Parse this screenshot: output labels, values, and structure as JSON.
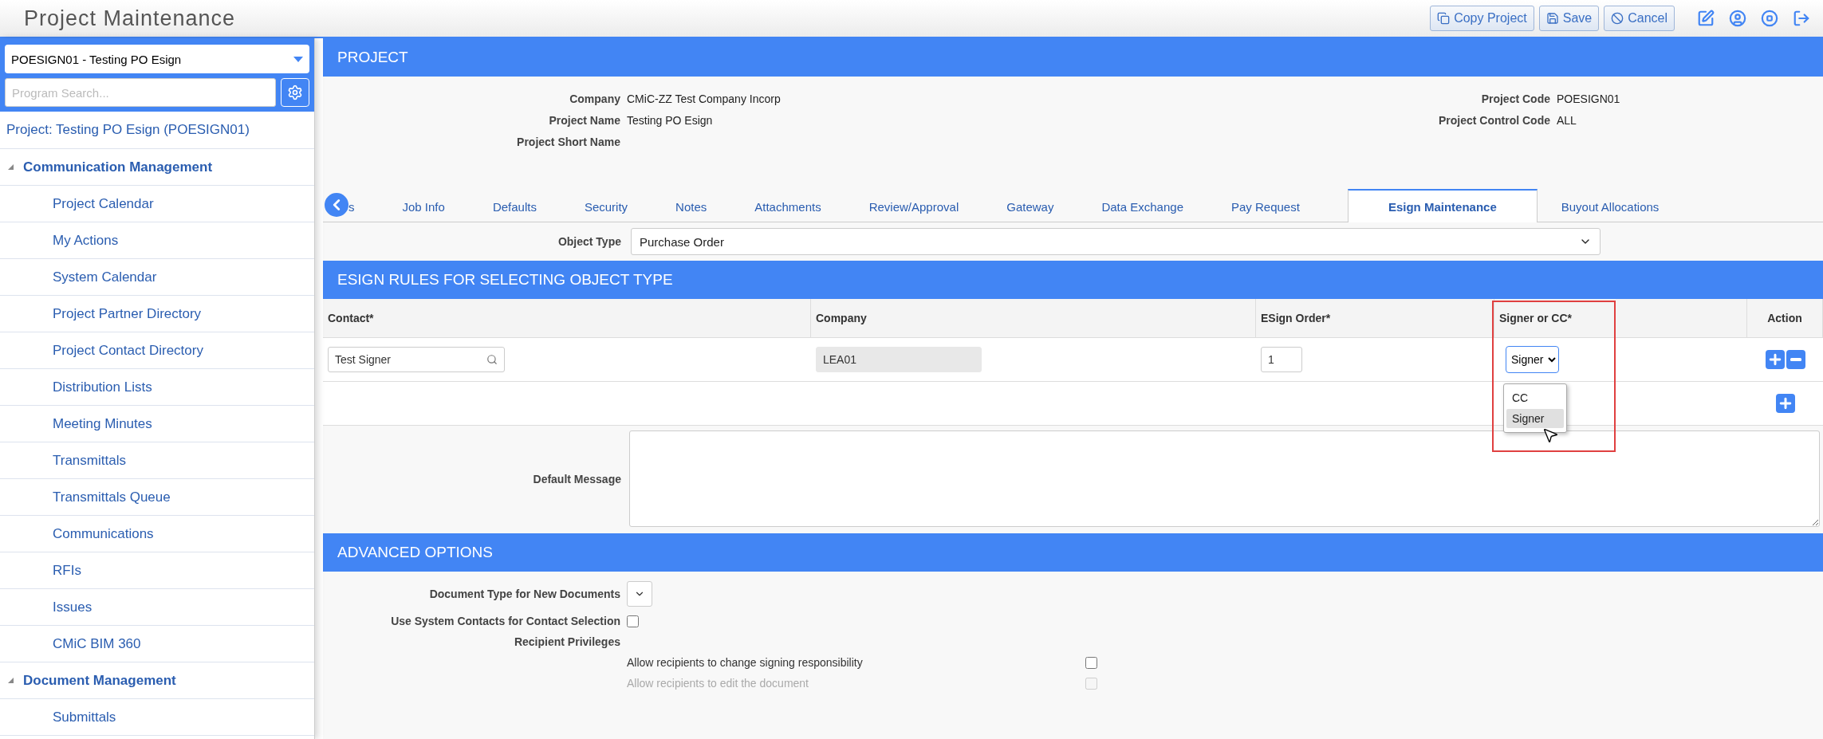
{
  "app": {
    "title": "Project Maintenance",
    "actions": [
      {
        "kind": "copy",
        "label": "Copy Project"
      },
      {
        "kind": "save",
        "label": "Save"
      },
      {
        "kind": "cancel",
        "label": "Cancel"
      }
    ],
    "tools": [
      {
        "kind": "edit"
      },
      {
        "kind": "user"
      },
      {
        "kind": "stop"
      },
      {
        "kind": "logout"
      }
    ]
  },
  "sidebar": {
    "project_select": "POESIGN01 - Testing PO Esign",
    "search": {
      "placeholder": "Program Search..."
    },
    "project_link": "Project: Testing PO Esign (POESIGN01)",
    "groups": [
      {
        "label": "Communication Management",
        "expanded": true,
        "children": [
          {
            "label": "Project Calendar"
          },
          {
            "label": "My Actions"
          },
          {
            "label": "System Calendar"
          },
          {
            "label": "Project Partner Directory"
          },
          {
            "label": "Project Contact Directory"
          },
          {
            "label": "Distribution Lists"
          },
          {
            "label": "Meeting Minutes"
          },
          {
            "label": "Transmittals"
          },
          {
            "label": "Transmittals Queue"
          },
          {
            "label": "Communications"
          },
          {
            "label": "RFIs"
          },
          {
            "label": "Issues"
          },
          {
            "label": "CMiC BIM 360"
          }
        ]
      },
      {
        "label": "Document Management",
        "expanded": true,
        "children": [
          {
            "label": "Submittals"
          }
        ]
      }
    ]
  },
  "project": {
    "header": "PROJECT",
    "fields_left": [
      {
        "label": "Company",
        "value": "CMiC-ZZ Test Company Incorp"
      },
      {
        "label": "Project Name",
        "value": "Testing PO Esign"
      },
      {
        "label": "Project Short Name"
      }
    ],
    "fields_right": [
      {
        "label": "Project Code",
        "value": "POESIGN01"
      },
      {
        "label": "Project Control Code",
        "value": "ALL"
      }
    ]
  },
  "tabs": [
    {
      "label": "s",
      "selected": false
    },
    {
      "label": "Job Info",
      "selected": false
    },
    {
      "label": "Defaults",
      "selected": false
    },
    {
      "label": "Security",
      "selected": false
    },
    {
      "label": "Notes",
      "selected": false
    },
    {
      "label": "Attachments",
      "selected": false
    },
    {
      "label": "Review/Approval",
      "selected": false
    },
    {
      "label": "Gateway",
      "selected": false
    },
    {
      "label": "Data Exchange",
      "selected": false
    },
    {
      "label": "Pay Request",
      "selected": false
    },
    {
      "label": "Esign Maintenance",
      "selected": true
    },
    {
      "label": "Buyout Allocations",
      "selected": false
    }
  ],
  "object_type": {
    "label": "Object Type",
    "value": "Purchase Order"
  },
  "esign": {
    "header": "ESIGN RULES FOR SELECTING OBJECT TYPE",
    "columns": [
      "Contact*",
      "Company",
      "ESign Order*",
      "Signer or CC*",
      "Action"
    ],
    "rows": [
      {
        "contact": "Test Signer",
        "company": "LEA01",
        "order": "1",
        "signer": "Signer",
        "options": [
          {
            "label": "CC",
            "selected": false
          },
          {
            "label": "Signer",
            "selected": true
          }
        ]
      }
    ],
    "message_label": "Default Message"
  },
  "advanced": {
    "header": "ADVANCED OPTIONS",
    "fields": [
      {
        "kind": "select",
        "label": "Document Type for New Documents"
      },
      {
        "kind": "checkbox",
        "label": "Use System Contacts for Contact Selection",
        "checked": false
      },
      {
        "kind": "heading",
        "label": "Recipient Privileges"
      }
    ],
    "privileges": [
      {
        "label": "Allow recipients to change signing responsibility",
        "checked": false,
        "disabled": false
      },
      {
        "label": "Allow recipients to edit the document",
        "checked": false,
        "disabled": true
      }
    ]
  }
}
